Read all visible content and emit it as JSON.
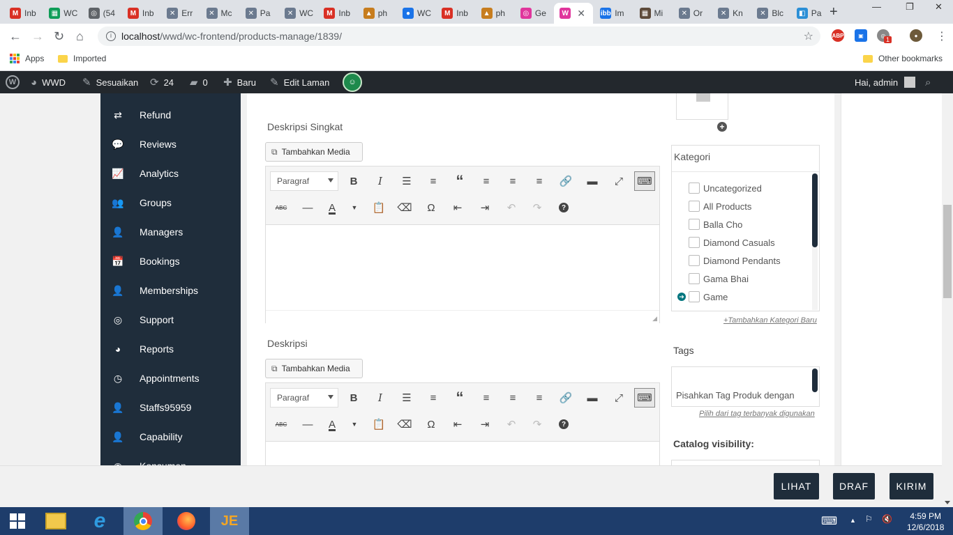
{
  "browser": {
    "tabs": [
      {
        "label": "Inb",
        "fav_color": "#d93025",
        "fav_glyph": "M"
      },
      {
        "label": "WC",
        "fav_color": "#0f9d58",
        "fav_glyph": "▦"
      },
      {
        "label": "(54",
        "fav_color": "#5f6368",
        "fav_glyph": "◎"
      },
      {
        "label": "Inb",
        "fav_color": "#d93025",
        "fav_glyph": "M"
      },
      {
        "label": "Err",
        "fav_color": "#6b7a8f",
        "fav_glyph": "✕"
      },
      {
        "label": "Mc",
        "fav_color": "#6b7a8f",
        "fav_glyph": "✕"
      },
      {
        "label": "Pa",
        "fav_color": "#6b7a8f",
        "fav_glyph": "✕"
      },
      {
        "label": "WC",
        "fav_color": "#6b7a8f",
        "fav_glyph": "✕"
      },
      {
        "label": "Inb",
        "fav_color": "#d93025",
        "fav_glyph": "M"
      },
      {
        "label": "ph",
        "fav_color": "#c77d1e",
        "fav_glyph": "▲"
      },
      {
        "label": "WC",
        "fav_color": "#1a73e8",
        "fav_glyph": "●"
      },
      {
        "label": "Inb",
        "fav_color": "#d93025",
        "fav_glyph": "M"
      },
      {
        "label": "ph",
        "fav_color": "#c77d1e",
        "fav_glyph": "▲"
      },
      {
        "label": "Ge",
        "fav_color": "#e0359c",
        "fav_glyph": "◎"
      },
      {
        "label": "",
        "fav_color": "#e0359c",
        "fav_glyph": "W",
        "active": true
      },
      {
        "label": "Im",
        "fav_color": "#1a73e8",
        "fav_glyph": "ibb"
      },
      {
        "label": "Mi",
        "fav_color": "#5d4a3a",
        "fav_glyph": "▦"
      },
      {
        "label": "Or",
        "fav_color": "#6b7a8f",
        "fav_glyph": "✕"
      },
      {
        "label": "Kn",
        "fav_color": "#6b7a8f",
        "fav_glyph": "✕"
      },
      {
        "label": "Blc",
        "fav_color": "#6b7a8f",
        "fav_glyph": "✕"
      },
      {
        "label": "Pa",
        "fav_color": "#2b8fd6",
        "fav_glyph": "◧"
      }
    ],
    "url_host": "localhost",
    "url_path": "/wwd/wc-frontend/products-manage/1839/",
    "ext_badge": "1"
  },
  "bookmarks": {
    "apps": "Apps",
    "imported": "Imported",
    "other": "Other bookmarks"
  },
  "adminbar": {
    "site": "WWD",
    "customize": "Sesuaikan",
    "updates": "24",
    "comments": "0",
    "new": "Baru",
    "edit_page": "Edit Laman",
    "greeting": "Hai, admin"
  },
  "sidebar": {
    "items": [
      {
        "label": "Refund",
        "icon": "refund-icon",
        "glyph": "⇄"
      },
      {
        "label": "Reviews",
        "icon": "comment-icon",
        "glyph": "💬"
      },
      {
        "label": "Analytics",
        "icon": "chart-icon",
        "glyph": "📈"
      },
      {
        "label": "Groups",
        "icon": "users-icon",
        "glyph": "👥"
      },
      {
        "label": "Managers",
        "icon": "manager-icon",
        "glyph": "👤"
      },
      {
        "label": "Bookings",
        "icon": "calendar-icon",
        "glyph": "📅"
      },
      {
        "label": "Memberships",
        "icon": "user-plus-icon",
        "glyph": "👤"
      },
      {
        "label": "Support",
        "icon": "lifebuoy-icon",
        "glyph": "◎"
      },
      {
        "label": "Reports",
        "icon": "pie-icon",
        "glyph": "◕"
      },
      {
        "label": "Appointments",
        "icon": "clock-icon",
        "glyph": "◷"
      },
      {
        "label": "Staffs95959",
        "icon": "user-icon",
        "glyph": "👤"
      },
      {
        "label": "Capability",
        "icon": "user-x-icon",
        "glyph": "👤"
      },
      {
        "label": "Konsumen",
        "icon": "customer-icon",
        "glyph": "◉"
      }
    ]
  },
  "short_desc": {
    "label": "Deskripsi Singkat",
    "media_button": "Tambahkan Media",
    "format": "Paragraf"
  },
  "desc": {
    "label": "Deskripsi",
    "media_button": "Tambahkan Media",
    "format": "Paragraf"
  },
  "kategori": {
    "title": "Kategori",
    "items": [
      "Uncategorized",
      "All Products",
      "Balla Cho",
      "Diamond Casuals",
      "Diamond Pendants",
      "Gama Bhai",
      "Game"
    ],
    "add_link": "+Tambahkan Kategori Baru"
  },
  "tags": {
    "title": "Tags",
    "placeholder": "Pisahkan Tag Produk dengan",
    "popular_link": "Pilih dari tag terbanyak digunakan"
  },
  "catalog": {
    "title": "Catalog visibility:"
  },
  "footer": {
    "view": "LIHAT",
    "draft": "DRAF",
    "submit": "KIRIM"
  },
  "taskbar": {
    "time": "4:59 PM",
    "date": "12/6/2018"
  },
  "colors": {
    "sidebar_bg": "#1f2d3b",
    "adminbar_bg": "#23282d",
    "taskbar_bg": "#1e3d6b",
    "accent_teal": "#00757e"
  }
}
